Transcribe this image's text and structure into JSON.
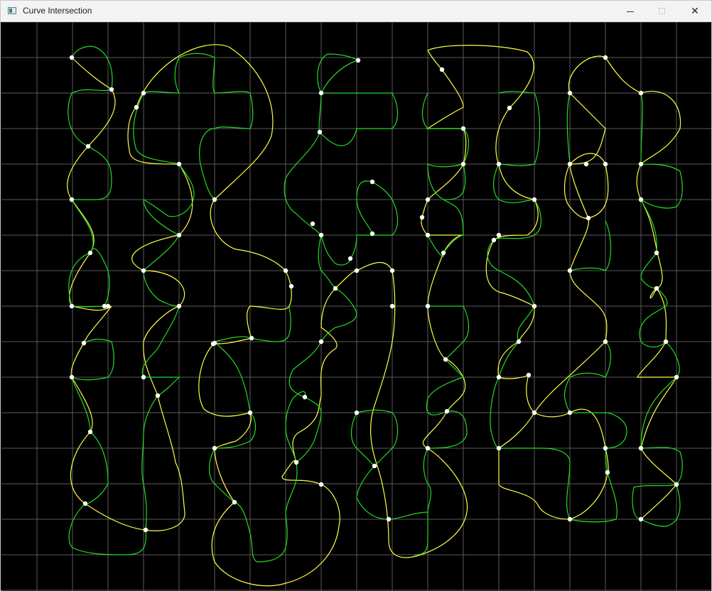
{
  "window": {
    "title": "Curve Intersection",
    "controls": {
      "minimize_icon": "minimize-icon",
      "maximize_icon": "maximize-icon",
      "close_icon": "close-icon",
      "close_glyph": "✕"
    }
  },
  "canvas": {
    "background": "#000000",
    "grid_color": "#5a5a5a",
    "curve_a_color": "#ffff44",
    "curve_b_color": "#22dd22",
    "point_color": "#ffffff"
  }
}
